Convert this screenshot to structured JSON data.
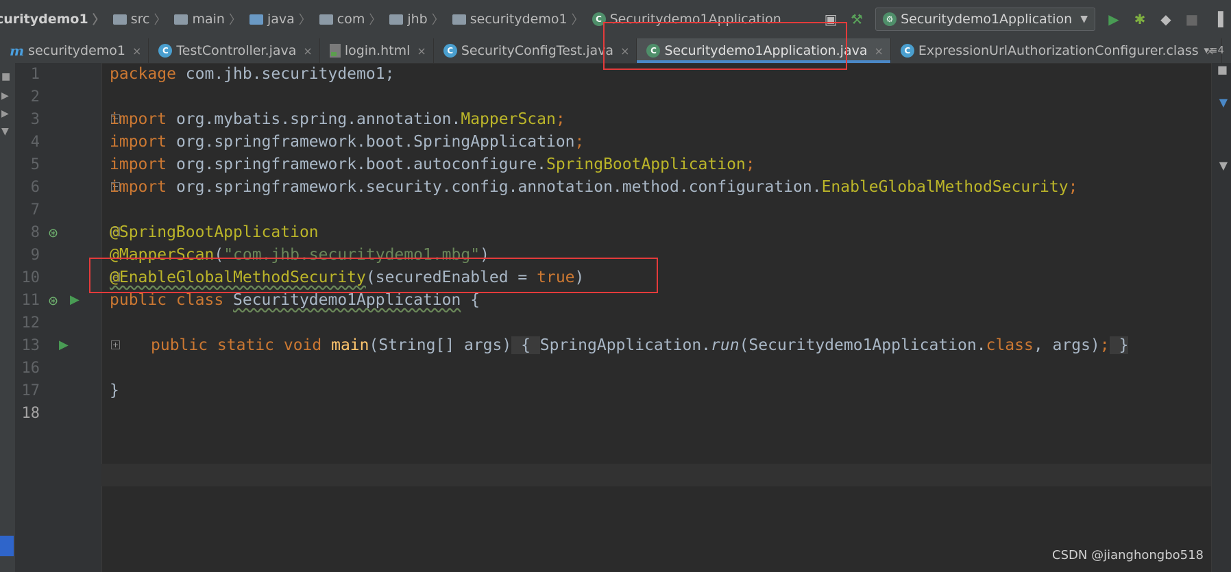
{
  "breadcrumb": {
    "project": "curitydemo1",
    "items": [
      "src",
      "main",
      "java",
      "com",
      "jhb",
      "securitydemo1",
      "Securitydemo1Application"
    ]
  },
  "run_config": {
    "label": "Securitydemo1Application"
  },
  "tabs": [
    {
      "label": "securitydemo1",
      "icon": "module-icon"
    },
    {
      "label": "TestController.java",
      "icon": "class-icon"
    },
    {
      "label": "login.html",
      "icon": "html-icon"
    },
    {
      "label": "SecurityConfigTest.java",
      "icon": "class-icon"
    },
    {
      "label": "Securitydemo1Application.java",
      "icon": "spring-class-icon",
      "active": true
    },
    {
      "label": "ExpressionUrlAuthorizationConfigurer.class",
      "icon": "class-icon"
    }
  ],
  "tab_overflow": "4",
  "line_numbers": [
    "1",
    "2",
    "3",
    "4",
    "5",
    "6",
    "7",
    "8",
    "9",
    "10",
    "11",
    "12",
    "13",
    "16",
    "17",
    "18"
  ],
  "code": {
    "l1_kw": "package",
    "l1_rest": " com.jhb.securitydemo1;",
    "l3_pkg": " org.mybatis.spring.annotation.",
    "l3_cls": "MapperScan",
    "l4_pkg": " org.springframework.boot.SpringApplication",
    "l5_pkg": " org.springframework.boot.autoconfigure.",
    "l5_cls": "SpringBootApplication",
    "l6_pkg": " org.springframework.security.config.annotation.method.configuration.",
    "l6_cls": "EnableGlobalMethodSecurity",
    "import_kw": "import",
    "semi": ";",
    "l8_ann": "@SpringBootApplication",
    "l9_ann": "@MapperScan",
    "l9_open": "(",
    "l9_str": "\"com.jhb.securitydemo1.mbg\"",
    "l9_close": ")",
    "l10_ann": "@EnableGlobalMethodSecurity",
    "l10_open": "(securedEnabled = ",
    "l10_true": "true",
    "l10_close": ")",
    "l11_kw": "public class ",
    "l11_name": "Securitydemo1Application",
    "l11_brace": " {",
    "l13_kw": "public static void ",
    "l13_fn": "main",
    "l13_args": "(String[] args)",
    "l13_ob": " { ",
    "l13_call": "SpringApplication.",
    "l13_run": "run",
    "l13_call2": "(Securitydemo1Application.",
    "l13_class": "class",
    "l13_tail": ", args)",
    "l13_cb": " }",
    "l17": "}"
  },
  "watermark": "CSDN @jianghongbo518"
}
